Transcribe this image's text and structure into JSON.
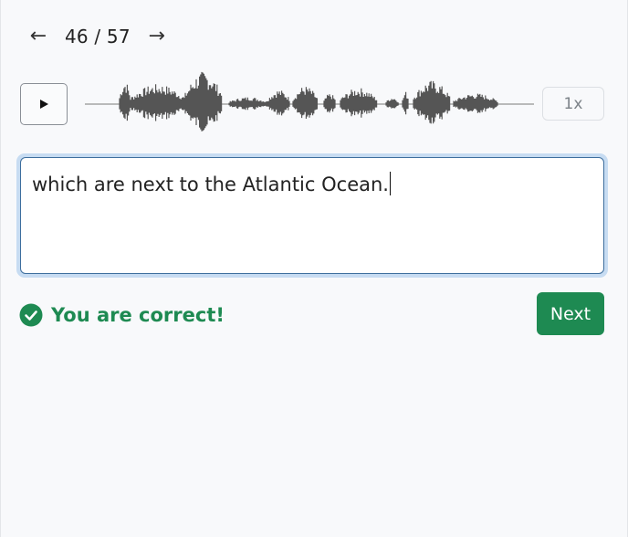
{
  "nav": {
    "prev_icon": "arrow-left-icon",
    "counter": "46 / 57",
    "next_icon": "arrow-right-icon"
  },
  "player": {
    "play_icon": "play-icon",
    "speed_label": "1x"
  },
  "answer": {
    "value": "which are next to the Atlantic Ocean."
  },
  "feedback": {
    "icon": "check-circle-icon",
    "message": "You are correct!",
    "color": "#1e8a52"
  },
  "actions": {
    "next_label": "Next",
    "next_color": "#1e8a52"
  }
}
